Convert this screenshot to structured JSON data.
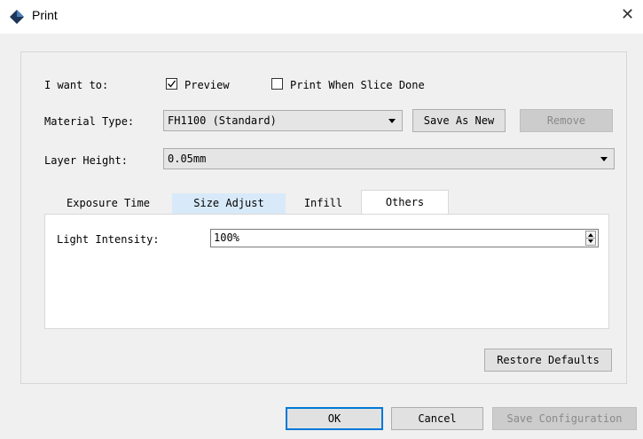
{
  "window": {
    "title": "Print",
    "app_icon": "diamond-app-icon",
    "close_icon": "close-icon"
  },
  "form": {
    "want_label": "I want to:",
    "preview": {
      "label": "Preview",
      "checked": true
    },
    "print_when_done": {
      "label": "Print When Slice Done",
      "checked": false
    },
    "material_label": "Material Type:",
    "material_value": "FH1100 (Standard)",
    "save_as_new": "Save As New",
    "remove": "Remove",
    "layer_label": "Layer Height:",
    "layer_value": "0.05mm"
  },
  "tabs": [
    {
      "label": "Exposure Time",
      "state": "normal"
    },
    {
      "label": "Size Adjust",
      "state": "hover"
    },
    {
      "label": "Infill",
      "state": "normal"
    },
    {
      "label": "Others",
      "state": "active"
    }
  ],
  "others": {
    "light_label": "Light Intensity:",
    "light_value": "100%"
  },
  "buttons": {
    "restore": "Restore Defaults",
    "ok": "OK",
    "cancel": "Cancel",
    "save_config": "Save Configuration"
  },
  "colors": {
    "accent": "#0078d7",
    "tab_hover": "#d8eaf9",
    "window_bg": "#f0f0f0"
  }
}
